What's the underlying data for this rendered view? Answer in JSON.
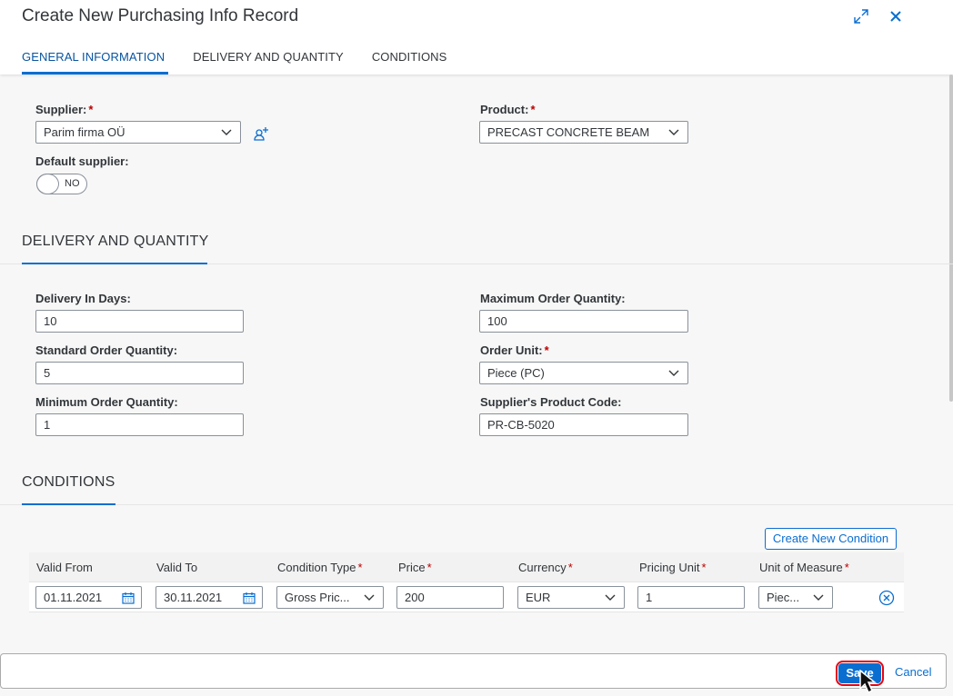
{
  "dialog": {
    "title": "Create New Purchasing Info Record",
    "tabs": [
      "GENERAL INFORMATION",
      "DELIVERY AND QUANTITY",
      "CONDITIONS"
    ]
  },
  "general": {
    "supplier_label": "Supplier:",
    "supplier_value": "Parim firma OÜ",
    "product_label": "Product:",
    "product_value": "PRECAST CONCRETE BEAM",
    "default_supplier_label": "Default supplier:",
    "default_supplier_toggle": "NO",
    "required_mark": "*"
  },
  "delivery": {
    "section_title": "DELIVERY AND QUANTITY",
    "delivery_days_label": "Delivery In Days:",
    "delivery_days_value": "10",
    "max_qty_label": "Maximum Order Quantity:",
    "max_qty_value": "100",
    "std_qty_label": "Standard Order Quantity:",
    "std_qty_value": "5",
    "order_unit_label": "Order Unit:",
    "order_unit_value": "Piece (PC)",
    "min_qty_label": "Minimum Order Quantity:",
    "min_qty_value": "1",
    "product_code_label": "Supplier's Product Code:",
    "product_code_value": "PR-CB-5020"
  },
  "conditions": {
    "section_title": "CONDITIONS",
    "create_button": "Create New Condition",
    "columns": [
      "Valid From",
      "Valid To",
      "Condition Type",
      "Price",
      "Currency",
      "Pricing Unit",
      "Unit of Measure"
    ],
    "row": {
      "valid_from": "01.11.2021",
      "valid_to": "30.11.2021",
      "condition_type": "Gross Pric...",
      "price": "200",
      "currency": "EUR",
      "pricing_unit": "1",
      "unit_of_measure": "Piec..."
    }
  },
  "footer": {
    "save": "Save",
    "cancel": "Cancel"
  },
  "icons": {
    "expand": "expand-icon",
    "close": "close-icon",
    "add_supplier": "add-person-icon",
    "dropdown": "chevron-down-icon",
    "calendar": "calendar-icon",
    "remove": "remove-circle-icon"
  },
  "colors": {
    "accent": "#0a6ed1",
    "required": "#bb0000",
    "highlight_ring": "#e30613"
  }
}
